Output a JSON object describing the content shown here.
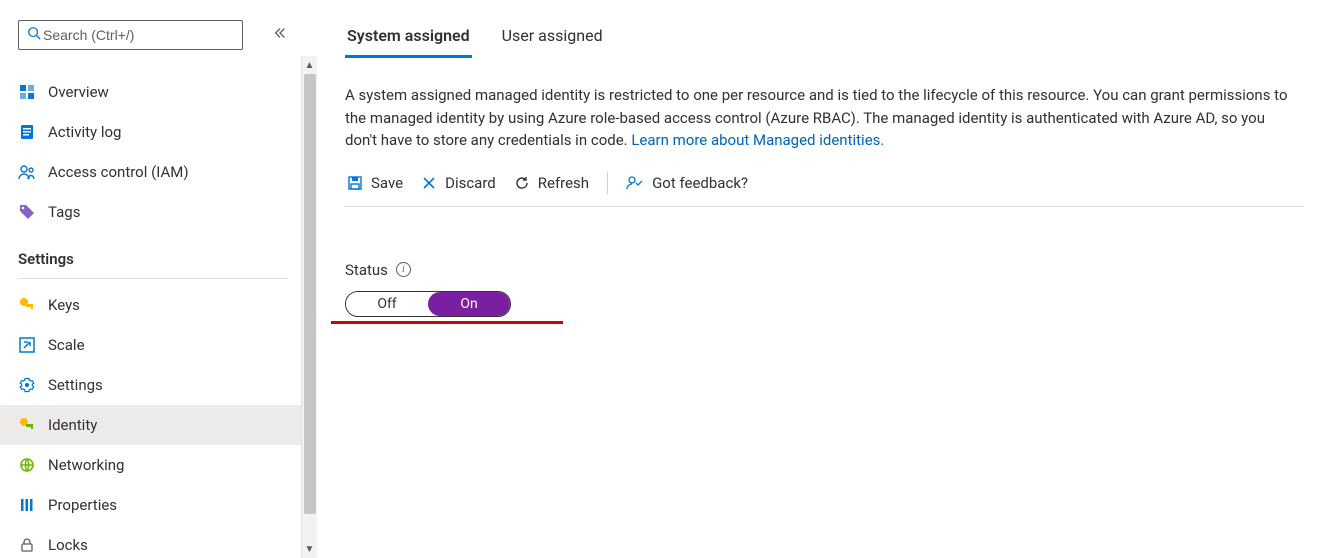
{
  "search": {
    "placeholder": "Search (Ctrl+/)"
  },
  "sidebar": {
    "top_items": [
      {
        "label": "Overview",
        "icon": "overview"
      },
      {
        "label": "Activity log",
        "icon": "activity-log"
      },
      {
        "label": "Access control (IAM)",
        "icon": "access-control"
      },
      {
        "label": "Tags",
        "icon": "tags"
      }
    ],
    "section_label": "Settings",
    "settings_items": [
      {
        "label": "Keys",
        "icon": "keys"
      },
      {
        "label": "Scale",
        "icon": "scale"
      },
      {
        "label": "Settings",
        "icon": "settings"
      },
      {
        "label": "Identity",
        "icon": "identity",
        "active": true
      },
      {
        "label": "Networking",
        "icon": "networking"
      },
      {
        "label": "Properties",
        "icon": "properties"
      },
      {
        "label": "Locks",
        "icon": "locks"
      }
    ]
  },
  "tabs": {
    "system_assigned": "System assigned",
    "user_assigned": "User assigned"
  },
  "description": {
    "text": "A system assigned managed identity is restricted to one per resource and is tied to the lifecycle of this resource. You can grant permissions to the managed identity by using Azure role-based access control (Azure RBAC). The managed identity is authenticated with Azure AD, so you don't have to store any credentials in code. ",
    "link_text": "Learn more about Managed identities."
  },
  "toolbar": {
    "save": "Save",
    "discard": "Discard",
    "refresh": "Refresh",
    "feedback": "Got feedback?"
  },
  "status": {
    "label": "Status",
    "off": "Off",
    "on": "On",
    "value": "On"
  },
  "colors": {
    "accent": "#0078d4",
    "link": "#0065b3",
    "toggle_on": "#7b1fa2",
    "annotation": "#d30000"
  }
}
